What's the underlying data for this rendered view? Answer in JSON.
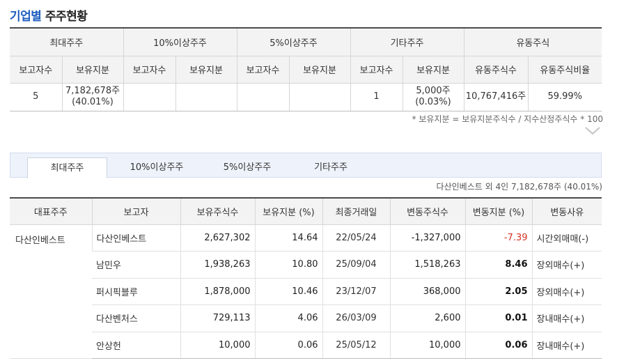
{
  "page": {
    "title_blue": "기업별",
    "title_dark": "주주현황"
  },
  "summary": {
    "groups": [
      "최대주주",
      "10%이상주주",
      "5%이상주주",
      "기타주주",
      "유동주식"
    ],
    "subheaders": [
      "보고자수",
      "보유지분",
      "보고자수",
      "보유지분",
      "보고자수",
      "보유지분",
      "보고자수",
      "보유지분",
      "유동주식수",
      "유동주식비율"
    ],
    "values": [
      "5",
      "7,182,678주 (40.01%)",
      "",
      "",
      "",
      "",
      "1",
      "5,000주 (0.03%)",
      "10,767,416주",
      "59.99%"
    ],
    "note": "* 보유지분 = 보유지분주식수 / 지수산정주식수 * 100"
  },
  "tabs": [
    {
      "label": "최대주주",
      "active": true
    },
    {
      "label": "10%이상주주",
      "active": false
    },
    {
      "label": "5%이상주주",
      "active": false
    },
    {
      "label": "기타주주",
      "active": false
    }
  ],
  "info_text": "다산인베스트 외 4인 7,182,678주 (40.01%)",
  "detail": {
    "headers": [
      "대표주주",
      "보고자",
      "보유주식수",
      "보유지분 (%)",
      "최종거래일",
      "변동주식수",
      "변동지분 (%)",
      "변동사유"
    ],
    "representative": "다산인베스트",
    "rows": [
      {
        "reporter": "다산인베스트",
        "shares": "2,627,302",
        "pct": "14.64",
        "date": "22/05/24",
        "change": "-1,327,000",
        "change_pct": "-7.39",
        "reason": "시간외매매(-)"
      },
      {
        "reporter": "남민우",
        "shares": "1,938,263",
        "pct": "10.80",
        "date": "25/09/04",
        "change": "1,518,263",
        "change_pct": "8.46",
        "reason": "장외매수(+)"
      },
      {
        "reporter": "퍼시픽블루",
        "shares": "1,878,000",
        "pct": "10.46",
        "date": "23/12/07",
        "change": "368,000",
        "change_pct": "2.05",
        "reason": "장외매수(+)"
      },
      {
        "reporter": "다산벤처스",
        "shares": "729,113",
        "pct": "4.06",
        "date": "26/03/09",
        "change": "2,600",
        "change_pct": "0.01",
        "reason": "장내매수(+)"
      },
      {
        "reporter": "안상헌",
        "shares": "10,000",
        "pct": "0.06",
        "date": "25/05/12",
        "change": "10,000",
        "change_pct": "0.06",
        "reason": "장내매수(+)"
      }
    ]
  },
  "colors": {
    "accent": "#1f5fbf",
    "negative": "#d93025"
  },
  "icons": {
    "expand": "chevron-down-icon"
  }
}
